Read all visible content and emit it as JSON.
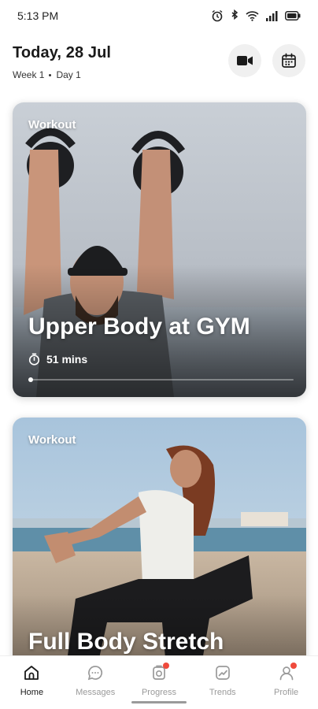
{
  "status_bar": {
    "time": "5:13 PM",
    "icons": [
      "alarm-icon",
      "bluetooth-icon",
      "wifi-icon",
      "signal-icon",
      "battery-icon"
    ]
  },
  "header": {
    "date": "Today, 28 Jul",
    "week": "Week 1",
    "day": "Day 1",
    "video_icon": "video-camera-icon",
    "calendar_icon": "calendar-icon"
  },
  "cards": [
    {
      "tag": "Workout",
      "title": "Upper Body at GYM",
      "duration": "51 mins",
      "progress": 0.0
    },
    {
      "tag": "Workout",
      "title": "Full Body Stretch"
    }
  ],
  "nav": {
    "items": [
      {
        "label": "Home",
        "icon": "home-icon",
        "active": true
      },
      {
        "label": "Messages",
        "icon": "chat-icon",
        "active": false
      },
      {
        "label": "Progress",
        "icon": "progress-icon",
        "active": false,
        "badge": true
      },
      {
        "label": "Trends",
        "icon": "trends-icon",
        "active": false
      },
      {
        "label": "Profile",
        "icon": "profile-icon",
        "active": false,
        "badge": true
      }
    ]
  },
  "colors": {
    "accent_badge": "#ef4a3c",
    "active_nav": "#1a1a1a",
    "inactive_nav": "#9a9a9a",
    "header_button_bg": "#f0f0f0"
  }
}
